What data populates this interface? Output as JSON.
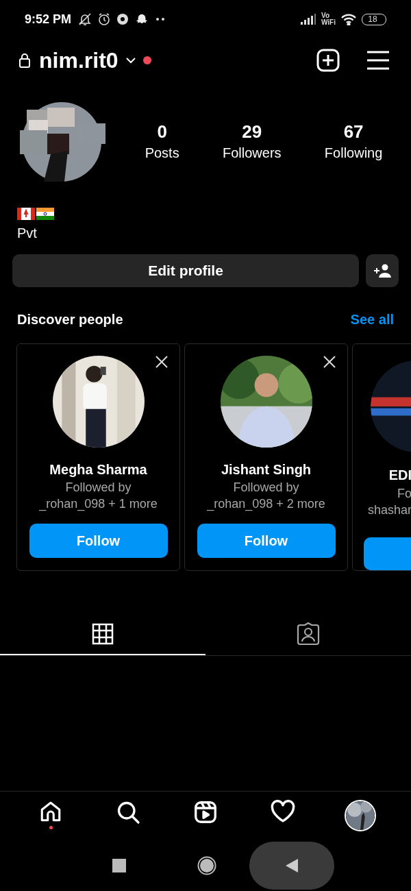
{
  "status_bar": {
    "time": "9:52 PM",
    "vowifi": [
      "Vo",
      "WiFi"
    ],
    "battery": "18"
  },
  "header": {
    "username": "nim.rit0",
    "notification_dot": true
  },
  "profile": {
    "stats": [
      {
        "value": "0",
        "label": "Posts"
      },
      {
        "value": "29",
        "label": "Followers"
      },
      {
        "value": "67",
        "label": "Following"
      }
    ],
    "bio": "Pvt",
    "edit_button": "Edit profile"
  },
  "discover": {
    "title": "Discover people",
    "see_all": "See all",
    "cards": [
      {
        "name": "Megha Sharma",
        "followed_by": "Followed by",
        "mutuals": "_rohan_098 + 1 more",
        "button": "Follow",
        "partial": false
      },
      {
        "name": "Jishant Singh",
        "followed_by": "Followed by",
        "mutuals": "_rohan_098 + 2 more",
        "button": "Follow",
        "partial": false
      },
      {
        "name": "EDI",
        "followed_by": "Fo",
        "mutuals": "shashar",
        "partial": true
      }
    ]
  },
  "tabs": [
    {
      "kind": "grid",
      "selected": true
    },
    {
      "kind": "tagged",
      "selected": false
    }
  ],
  "bottom_nav": [
    {
      "kind": "home",
      "badge": true
    },
    {
      "kind": "search",
      "badge": false
    },
    {
      "kind": "reels",
      "badge": false
    },
    {
      "kind": "heart",
      "badge": false
    },
    {
      "kind": "avatar",
      "badge": false
    }
  ]
}
